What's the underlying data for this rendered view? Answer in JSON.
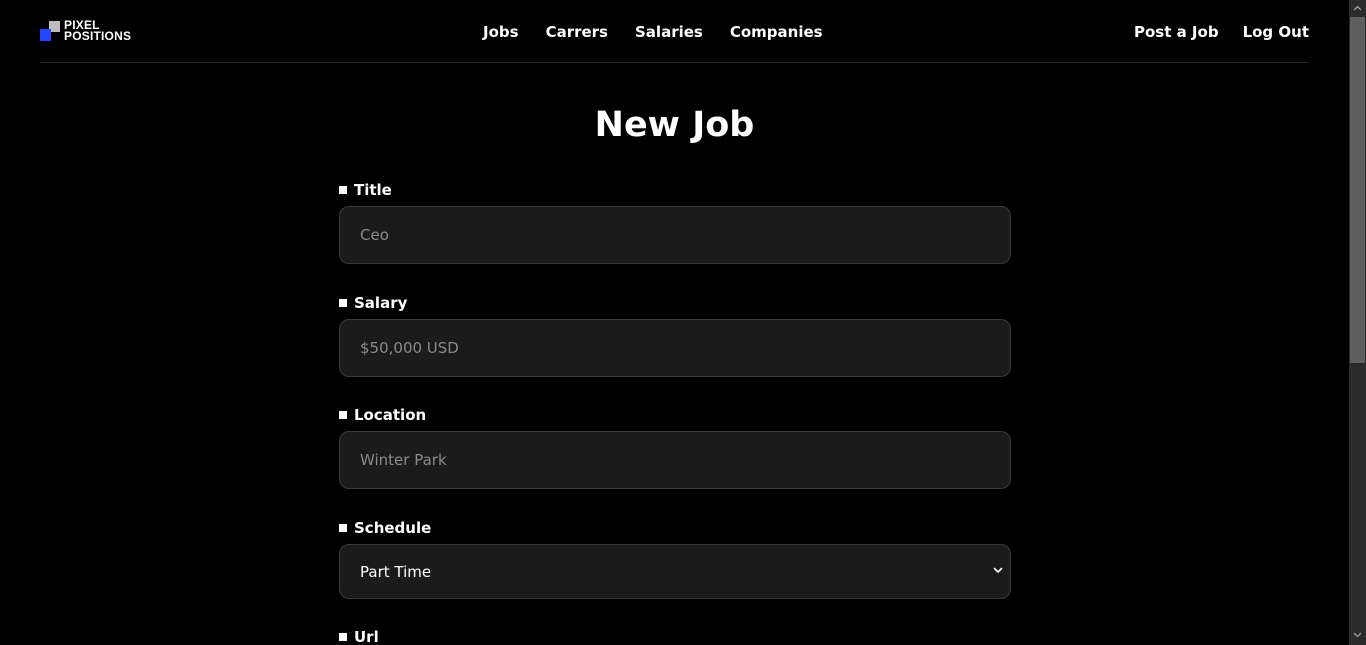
{
  "brand": {
    "line1": "PIXEL",
    "line2": "POSITIONS",
    "accent": "#2446ff"
  },
  "nav": {
    "items": [
      {
        "label": "Jobs"
      },
      {
        "label": "Carrers"
      },
      {
        "label": "Salaries"
      },
      {
        "label": "Companies"
      }
    ]
  },
  "actions": {
    "post_job": "Post a Job",
    "log_out": "Log Out"
  },
  "page": {
    "title": "New Job"
  },
  "form": {
    "title": {
      "label": "Title",
      "placeholder": "Ceo"
    },
    "salary": {
      "label": "Salary",
      "placeholder": "$50,000 USD"
    },
    "location": {
      "label": "Location",
      "placeholder": "Winter Park"
    },
    "schedule": {
      "label": "Schedule",
      "value": "Part Time",
      "icon": "chevron-down-icon"
    },
    "url": {
      "label": "Url"
    }
  }
}
